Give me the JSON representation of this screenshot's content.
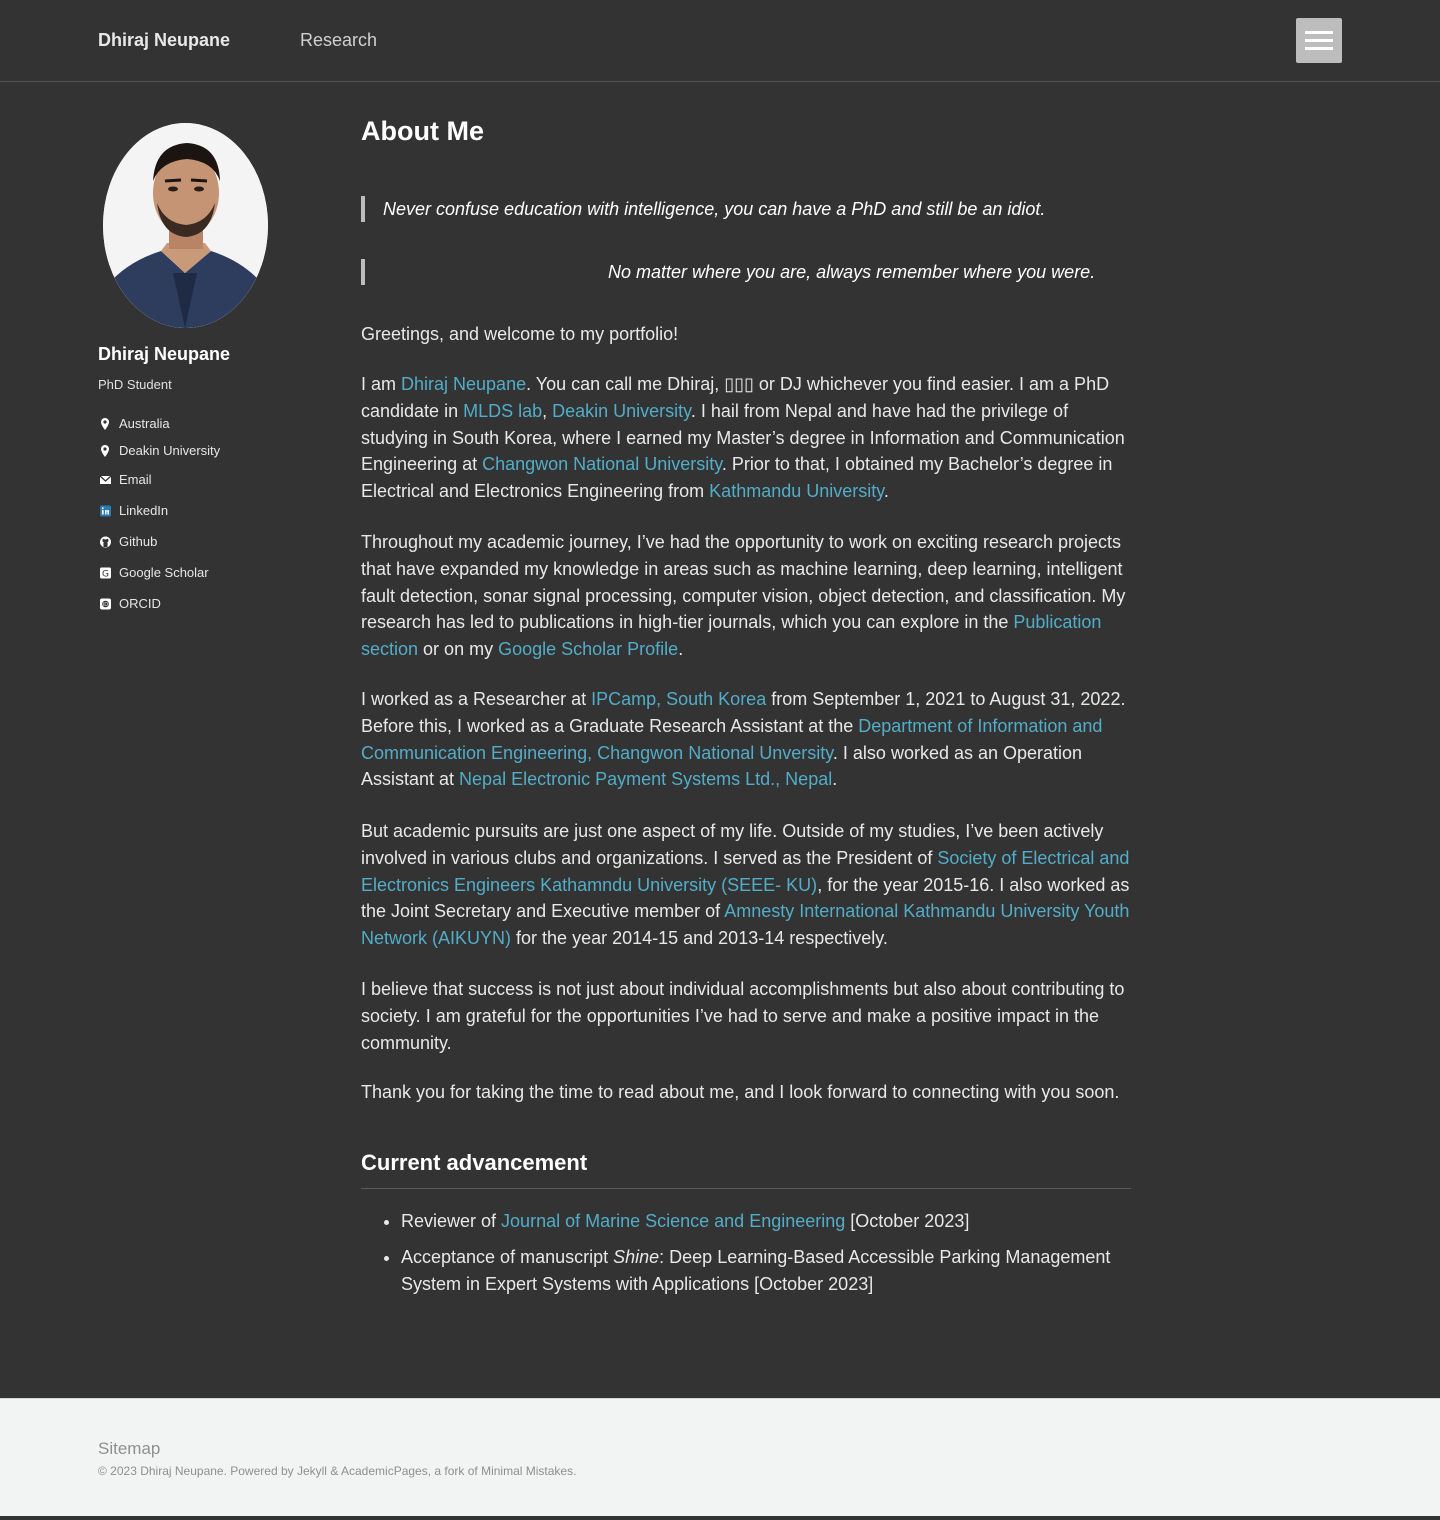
{
  "masthead": {
    "site_title": "Dhiraj Neupane",
    "nav": [
      {
        "label": "Research"
      }
    ],
    "menu_icon": "hamburger-icon"
  },
  "sidebar": {
    "name": "Dhiraj Neupane",
    "bio": "PhD Student",
    "items": [
      {
        "label": "Australia",
        "icon": "map-marker-icon"
      },
      {
        "label": "Deakin University",
        "icon": "map-marker-icon"
      },
      {
        "label": "Email",
        "icon": "envelope-icon"
      },
      {
        "label": "LinkedIn",
        "icon": "linkedin-icon"
      },
      {
        "label": "Github",
        "icon": "github-icon"
      },
      {
        "label": "Google Scholar",
        "icon": "google-scholar-icon"
      },
      {
        "label": "ORCID",
        "icon": "orcid-icon"
      }
    ]
  },
  "main": {
    "title": "About Me",
    "quotes": [
      "Never confuse education with intelligence, you can have a PhD and still be an idiot.",
      "No matter where you are, always remember where you were."
    ],
    "greeting": "Greetings, and welcome to my portfolio!",
    "p1": {
      "t1": "I am ",
      "l1": "Dhiraj Neupane",
      "t2": ". You can call me Dhiraj, ▯▯▯ or DJ whichever you find easier. I am a PhD candidate in ",
      "l2": "MLDS lab",
      "t3": ", ",
      "l3": "Deakin University",
      "t4": ". I hail from Nepal and have had the privilege of studying in South Korea, where I earned my Master’s degree in Information and Communication Engineering at ",
      "l4": "Changwon National University",
      "t5": ". Prior to that, I obtained my Bachelor’s degree in Electrical and Electronics Engineering from ",
      "l5": "Kathmandu University",
      "t6": "."
    },
    "p2": {
      "t1": "Throughout my academic journey, I’ve had the opportunity to work on exciting research projects that have expanded my knowledge in areas such as machine learning, deep learning, intelligent fault detection, sonar signal processing, computer vision, object detection, and classification. My research has led to publications in high-tier journals, which you can explore in the ",
      "l1": "Publication section",
      "t2": " or on my ",
      "l2": "Google Scholar Profile",
      "t3": "."
    },
    "p3": {
      "t1": "I worked as a Researcher at ",
      "l1": "IPCamp, South Korea",
      "t2": " from September 1, 2021 to August 31, 2022. Before this, I worked as a Graduate Research Assistant at the ",
      "l2": "Department of Information and Communication Engineering, Changwon National Unversity",
      "t3": ". I also worked as an Operation Assistant at ",
      "l3": "Nepal Electronic Payment Systems Ltd., Nepal",
      "t4": "."
    },
    "p4": {
      "t1": "But academic pursuits are just one aspect of my life. Outside of my studies, I’ve been actively involved in various clubs and organizations. I served as the President of ",
      "l1": "Society of Electrical and Electronics Engineers Kathamndu University (SEEE- KU)",
      "t2": ", for the year 2015-16. I also worked as the Joint Secretary and Executive member of ",
      "l2": "Amnesty International Kathmandu University Youth Network (AIKUYN)",
      "t3": " for the year 2014-15 and 2013-14 respectively."
    },
    "p5": "I believe that success is not just about individual accomplishments but also about contributing to society. I am grateful for the opportunities I’ve had to serve and make a positive impact in the community.",
    "p6": "Thank you for taking the time to read about me, and I look forward to connecting with you soon.",
    "advancement": {
      "heading": "Current advancement",
      "item1": {
        "t1": "Reviewer of ",
        "l1": "Journal of Marine Science and Engineering",
        "t2": " [October 2023]"
      },
      "item2": {
        "t1": "Acceptance of manuscript ",
        "em": "Shine",
        "t2": ": Deep Learning-Based Accessible Parking Management System in Expert Systems with Applications [October 2023]"
      }
    }
  },
  "footer": {
    "sitemap": "Sitemap",
    "copyright_prefix": "© 2023 Dhiraj Neupane. Powered by ",
    "jekyll": "Jekyll",
    "amp": " & ",
    "academicpages": "AcademicPages",
    "fork_text": ", a fork of ",
    "minimal_mistakes": "Minimal Mistakes",
    "end": "."
  },
  "colors": {
    "background": "#333333",
    "link": "#52adc8",
    "footer_bg": "#f2f3f3"
  }
}
